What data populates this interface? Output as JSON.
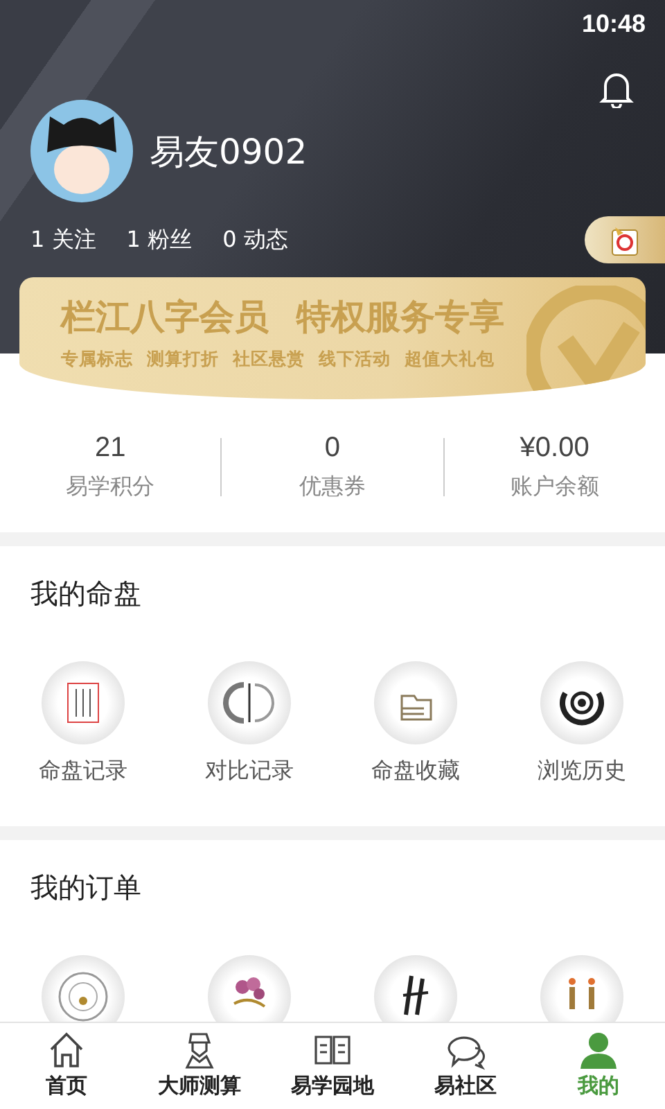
{
  "status_bar": {
    "time": "10:48"
  },
  "profile": {
    "name": "易友0902",
    "stats": [
      {
        "count": "1",
        "label": "关注"
      },
      {
        "count": "1",
        "label": "粉丝"
      },
      {
        "count": "0",
        "label": "动态"
      }
    ]
  },
  "banner": {
    "title_parts": [
      "栏江八字会员",
      "特权服务专享"
    ],
    "perks": [
      "专属标志",
      "测算打折",
      "社区悬赏",
      "线下活动",
      "超值大礼包"
    ]
  },
  "wallet": [
    {
      "value": "21",
      "label": "易学积分"
    },
    {
      "value": "0",
      "label": "优惠券"
    },
    {
      "value": "¥0.00",
      "label": "账户余额"
    }
  ],
  "sections": [
    {
      "title": "我的命盘",
      "items": [
        {
          "label": "命盘记录",
          "kind": "scroll"
        },
        {
          "label": "对比记录",
          "kind": "compare"
        },
        {
          "label": "命盘收藏",
          "kind": "folder"
        },
        {
          "label": "浏览历史",
          "kind": "eye"
        }
      ]
    },
    {
      "title": "我的订单",
      "items": [
        {
          "kind": "compass"
        },
        {
          "kind": "flower"
        },
        {
          "kind": "brush"
        },
        {
          "kind": "candles"
        }
      ]
    }
  ],
  "tab_bar": [
    {
      "label": "首页",
      "kind": "home",
      "selected": false
    },
    {
      "label": "大师测算",
      "kind": "master",
      "selected": false
    },
    {
      "label": "易学园地",
      "kind": "book",
      "selected": false
    },
    {
      "label": "易社区",
      "kind": "chat",
      "selected": false
    },
    {
      "label": "我的",
      "kind": "person",
      "selected": true
    }
  ]
}
